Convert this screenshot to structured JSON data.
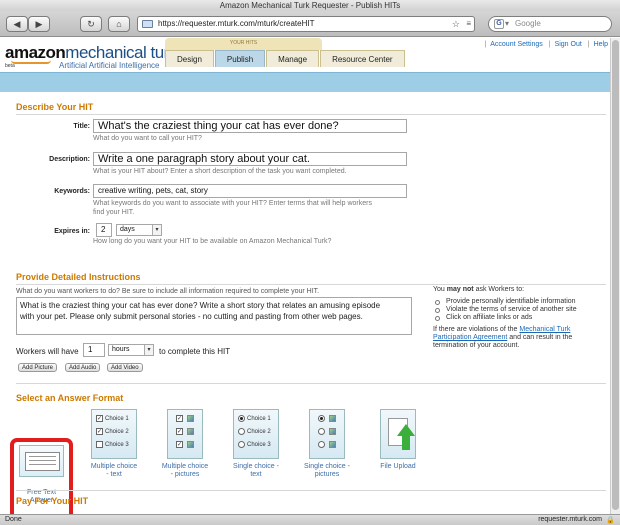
{
  "window": {
    "title": "Amazon Mechanical Turk Requester - Publish HITs"
  },
  "browser": {
    "url": "https://requester.mturk.com/mturk/createHIT",
    "search_placeholder": "Google",
    "status_left": "Done",
    "status_right": "requester.mturk.com"
  },
  "header": {
    "logo_amazon": "amazon",
    "logo_mt": "mechanical turk",
    "tagline": "Artificial Artificial Intelligence",
    "beta": "beta",
    "your_hits": "YOUR HITS",
    "tabs": [
      "Design",
      "Publish",
      "Manage",
      "Resource Center"
    ],
    "active_tab": "Publish",
    "links": [
      "Account Settings",
      "Sign Out",
      "Help"
    ]
  },
  "describe": {
    "title": "Describe Your HIT",
    "title_label": "Title:",
    "title_value": "What's the craziest thing your cat has ever done?",
    "title_help": "What do you want to call your HIT?",
    "desc_label": "Description:",
    "desc_value": "Write a one paragraph story about your cat.",
    "desc_help": "What is your HIT about? Enter a short description of the task you want completed.",
    "kw_label": "Keywords:",
    "kw_value": "creative writing, pets, cat, story",
    "kw_help1": "What keywords do you want to associate with your HIT? Enter terms that will help workers",
    "kw_help2": "find your HIT.",
    "exp_label": "Expires in:",
    "exp_value": "2",
    "exp_unit": "days",
    "exp_help": "How long do you want your HIT to be available on Amazon Mechanical Turk?"
  },
  "instructions": {
    "title": "Provide Detailed Instructions",
    "help": "What do you want workers to do? Be sure to include all information required to complete your HIT.",
    "line1": "What is the craziest thing your cat has ever done? Write a short story that relates an amusing episode",
    "line2": "with your pet. Please only submit personal stories - no cutting and pasting from other web pages.",
    "workers_pre": "Workers will have",
    "workers_value": "1",
    "workers_unit": "hours",
    "workers_post": "to complete this HIT",
    "btn_picture": "Add Picture",
    "btn_audio": "Add Audio",
    "btn_video": "Add Video",
    "rules_you": "You",
    "rules_may_not": "may not",
    "rules_ask": "ask Workers to:",
    "rules": [
      "Provide personally identifiable information",
      "Violate the terms of service of another site",
      "Click on affiliate links or ads"
    ],
    "rules_note_pre": "If there are violations of the",
    "rules_note_link1": "Mechanical Turk",
    "rules_note_link2": "Participation Agreement",
    "rules_note_mid": "and can result in the",
    "rules_note_end": "termination of your account."
  },
  "answer_format": {
    "title": "Select an Answer Format",
    "options": [
      {
        "label1": "Free Text",
        "label2": "Answer"
      },
      {
        "label1": "Multiple choice",
        "label2": "- text"
      },
      {
        "label1": "Multiple choice",
        "label2": "- pictures"
      },
      {
        "label1": "Single choice -",
        "label2": "text"
      },
      {
        "label1": "Single choice -",
        "label2": "pictures"
      },
      {
        "label1": "File Upload",
        "label2": ""
      }
    ],
    "choices": [
      "Choice 1",
      "Choice 2",
      "Choice 3"
    ],
    "selected": "Free Text Answer"
  },
  "pay": {
    "title": "Pay For Your HIT"
  },
  "colors": {
    "accent_orange": "#cc7a00",
    "link_blue": "#1a69b7",
    "highlight_red": "#e11d1d",
    "banner_blue": "#9ecde6"
  },
  "icons": [
    "back-arrow",
    "forward-arrow",
    "reload",
    "home",
    "star",
    "rss",
    "google",
    "magnifier",
    "lock"
  ]
}
